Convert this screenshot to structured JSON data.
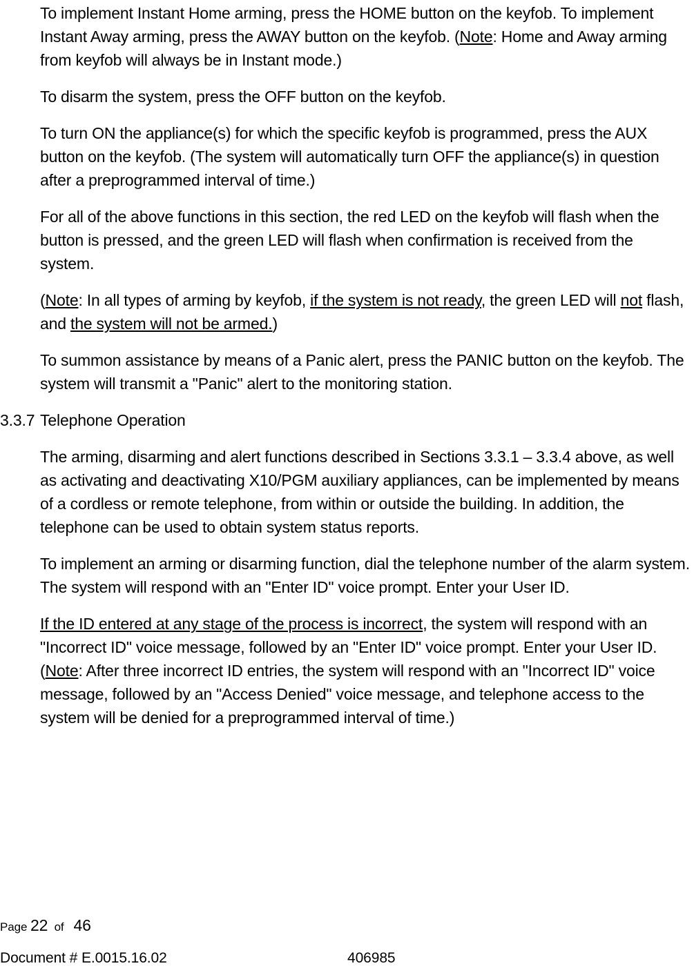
{
  "document": {
    "body_paragraphs": [
      {
        "id": "instant-arming",
        "runs": [
          {
            "text": "To implement Instant Home arming, press the HOME button on the keyfob. To implement Instant Away arming, press the AWAY button on the keyfob. (",
            "underline": false
          },
          {
            "text": "Note",
            "underline": true
          },
          {
            "text": ": Home and Away arming from keyfob will always be in Instant mode.)",
            "underline": false
          }
        ]
      },
      {
        "id": "disarm",
        "runs": [
          {
            "text": "To disarm the system, press the OFF button on the keyfob.",
            "underline": false
          }
        ]
      },
      {
        "id": "appliance-aux",
        "runs": [
          {
            "text": "To turn ON the appliance(s) for which the specific keyfob is programmed, press the AUX button on the keyfob. (The system will automatically turn OFF the appliance(s) in question after a preprogrammed interval of time.)",
            "underline": false
          }
        ]
      },
      {
        "id": "led-indication",
        "runs": [
          {
            "text": "For all of the above functions in this section, the red LED on the keyfob will flash when the button is pressed, and the green LED will flash when confirmation is received from the system.",
            "underline": false
          }
        ]
      },
      {
        "id": "note-not-ready",
        "runs": [
          {
            "text": "(",
            "underline": false
          },
          {
            "text": "Note",
            "underline": true
          },
          {
            "text": ": In all types of arming by keyfob, ",
            "underline": false
          },
          {
            "text": "if the system is not ready",
            "underline": true
          },
          {
            "text": ", the green LED will ",
            "underline": false
          },
          {
            "text": "not",
            "underline": true
          },
          {
            "text": " flash, and ",
            "underline": false
          },
          {
            "text": "the system will not be armed.",
            "underline": true
          },
          {
            "text": ")",
            "underline": false
          }
        ]
      },
      {
        "id": "panic-alert",
        "runs": [
          {
            "text": "To summon assistance by means of a Panic alert, press the PANIC button on the keyfob. The system will transmit a \"Panic\" alert to the monitoring station.",
            "underline": false
          }
        ]
      }
    ],
    "section_heading": {
      "number": "3.3.7",
      "title": "Telephone Operation"
    },
    "section_paragraphs": [
      {
        "id": "telephone-overview",
        "runs": [
          {
            "text": "The arming, disarming and alert functions described in Sections 3.3.1 – 3.3.4 above, as well as activating and deactivating X10/PGM auxiliary appliances, can be implemented by means of a cordless or remote telephone, from within or outside the building. In addition, the telephone can be used to obtain system status reports.",
            "underline": false
          }
        ]
      },
      {
        "id": "telephone-arm-disarm",
        "runs": [
          {
            "text": "To implement an arming or disarming function, dial the telephone number of the alarm system. The system will respond with an \"Enter ID\" voice prompt. Enter your User ID.",
            "underline": false
          }
        ]
      },
      {
        "id": "incorrect-id",
        "runs": [
          {
            "text": "If the ID entered at any stage of the process is incorrect",
            "underline": true
          },
          {
            "text": ", the system will respond with an \"Incorrect ID\" voice message, followed by an \"Enter ID\" voice prompt. Enter your User ID. (",
            "underline": false
          },
          {
            "text": "Note",
            "underline": true
          },
          {
            "text": ": After three incorrect ID entries, the system will respond with an \"Incorrect ID\" voice message, followed by an \"Access Denied\" voice message, and telephone access to the system will be denied for a preprogrammed interval of time.)",
            "underline": false
          }
        ]
      }
    ]
  },
  "footer": {
    "page_label": "Page",
    "page_number": "22",
    "of_label": "of",
    "page_total": "46",
    "document_id": "Document # E.0015.16.02",
    "document_code": "406985"
  }
}
